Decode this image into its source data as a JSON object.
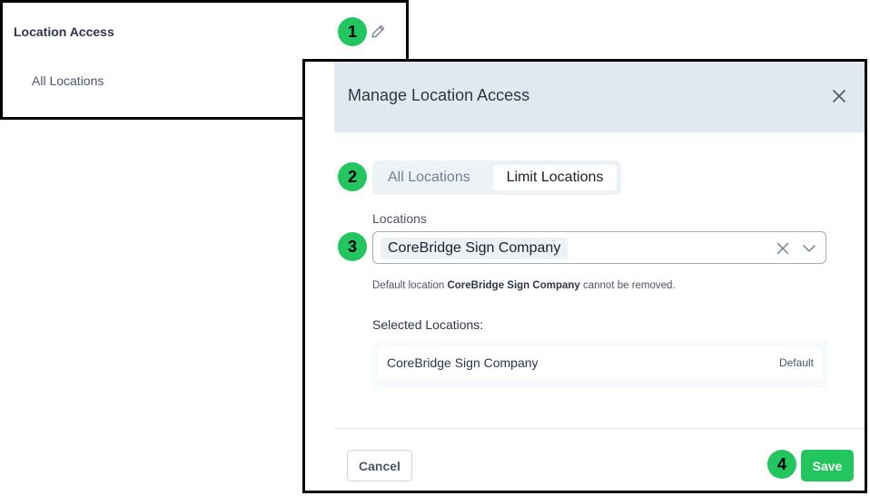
{
  "back_panel": {
    "title": "Location Access",
    "value": "All Locations"
  },
  "steps": [
    "1",
    "2",
    "3",
    "4"
  ],
  "modal": {
    "title": "Manage Location Access",
    "segmented": {
      "options": [
        "All Locations",
        "Limit Locations"
      ],
      "selected": "Limit Locations"
    },
    "locations_label": "Locations",
    "selected_chip": "CoreBridge Sign Company",
    "help_prefix": "Default location ",
    "help_bold": "CoreBridge Sign Company",
    "help_suffix": " cannot be removed.",
    "selected_title": "Selected Locations:",
    "selected_items": [
      {
        "name": "CoreBridge Sign Company",
        "badge": "Default"
      }
    ],
    "cancel_label": "Cancel",
    "save_label": "Save"
  },
  "icons": {
    "edit": "pencil-icon",
    "close": "close-icon",
    "clear": "clear-icon",
    "dropdown": "chevron-down-icon"
  },
  "colors": {
    "accent_green": "#22c55e",
    "header_bg": "#e2e8f0"
  }
}
